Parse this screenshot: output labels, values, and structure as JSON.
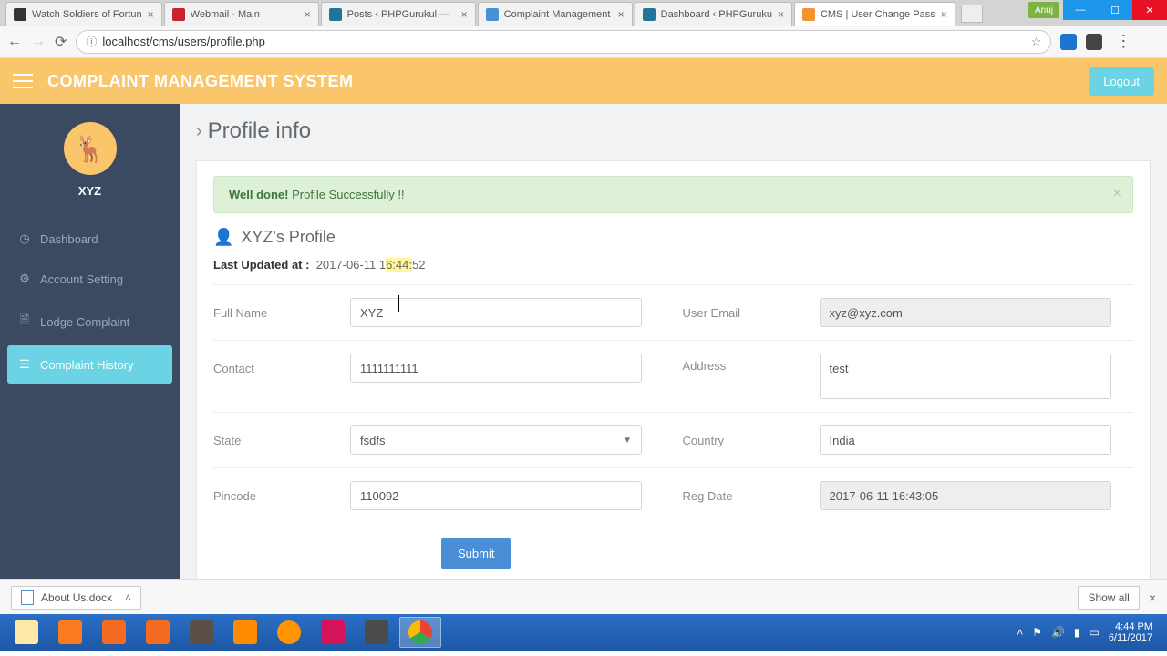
{
  "browser": {
    "tabs": [
      {
        "title": "Watch Soldiers of Fortun"
      },
      {
        "title": "Webmail - Main"
      },
      {
        "title": "Posts ‹ PHPGurukul — "
      },
      {
        "title": "Complaint Management"
      },
      {
        "title": "Dashboard ‹ PHPGuruku"
      },
      {
        "title": "CMS | User Change Pass"
      }
    ],
    "url": "localhost/cms/users/profile.php",
    "user_badge": "Anuj"
  },
  "header": {
    "app_title": "COMPLAINT MANAGEMENT SYSTEM",
    "logout": "Logout"
  },
  "sidebar": {
    "user": "XYZ",
    "items": [
      {
        "label": "Dashboard"
      },
      {
        "label": "Account Setting"
      },
      {
        "label": "Lodge Complaint"
      },
      {
        "label": "Complaint History"
      }
    ]
  },
  "page": {
    "title": "Profile info",
    "alert_strong": "Well done!",
    "alert_text": " Profile Successfully !!",
    "panel_title": "XYZ's Profile",
    "updated_label": "Last Updated at :",
    "updated_time_pre": "2017-06-11 1",
    "updated_time_hl": "6:44:",
    "updated_time_post": "52",
    "labels": {
      "fullname": "Full Name",
      "email": "User Email",
      "contact": "Contact",
      "address": "Address",
      "state": "State",
      "country": "Country",
      "pincode": "Pincode",
      "regdate": "Reg Date"
    },
    "values": {
      "fullname": "XYZ",
      "email": "xyz@xyz.com",
      "contact": "1111111111",
      "address": "test",
      "state": "fsdfs",
      "country": "India",
      "pincode": "110092",
      "regdate": "2017-06-11 16:43:05"
    },
    "submit": "Submit"
  },
  "downloads": {
    "item": "About Us.docx",
    "show_all": "Show all"
  },
  "tray": {
    "time": "4:44 PM",
    "date": "6/11/2017"
  }
}
